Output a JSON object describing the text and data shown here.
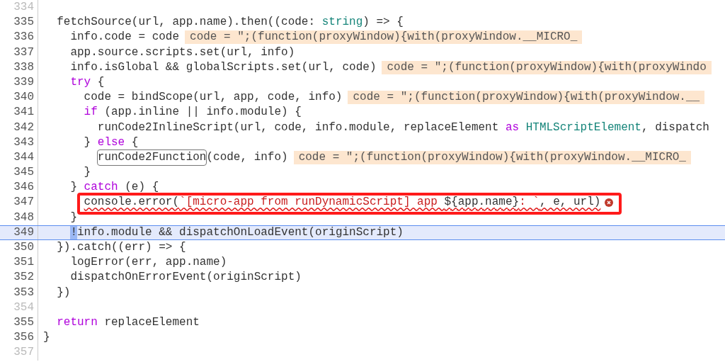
{
  "editor": {
    "lines": [
      {
        "number": "334"
      },
      {
        "number": "335",
        "tokens": [
          {
            "kind": "plain",
            "text": "  fetchSource(url, app.name).then((code: "
          },
          {
            "kind": "type",
            "text": "string"
          },
          {
            "kind": "plain",
            "text": ") => {"
          }
        ]
      },
      {
        "number": "336",
        "tokens": [
          {
            "kind": "plain",
            "text": "    info.code = code"
          },
          {
            "kind": "hint",
            "text": "code = \";(function(proxyWindow){with(proxyWindow.__MICRO_"
          }
        ]
      },
      {
        "number": "337",
        "tokens": [
          {
            "kind": "plain",
            "text": "    app.source.scripts.set(url, info)"
          }
        ]
      },
      {
        "number": "338",
        "tokens": [
          {
            "kind": "plain",
            "text": "    info.isGlobal && globalScripts.set(url, code)"
          },
          {
            "kind": "hint",
            "text": "code = \";(function(proxyWindow){with(proxyWindo"
          }
        ]
      },
      {
        "number": "339",
        "tokens": [
          {
            "kind": "keyword",
            "text": "    try"
          },
          {
            "kind": "plain",
            "text": " {"
          }
        ]
      },
      {
        "number": "340",
        "tokens": [
          {
            "kind": "plain",
            "text": "      code = bindScope(url, app, code, info)"
          },
          {
            "kind": "hint",
            "text": "code = \";(function(proxyWindow){with(proxyWindow.__"
          }
        ]
      },
      {
        "number": "341",
        "tokens": [
          {
            "kind": "keyword",
            "text": "      if"
          },
          {
            "kind": "plain",
            "text": " (app.inline || info.module) {"
          }
        ]
      },
      {
        "number": "342",
        "tokens": [
          {
            "kind": "plain",
            "text": "        runCode2InlineScript(url, code, info.module, replaceElement "
          },
          {
            "kind": "keyword",
            "text": "as"
          },
          {
            "kind": "type",
            "text": " HTMLScriptElement"
          },
          {
            "kind": "plain",
            "text": ", dispatch"
          }
        ]
      },
      {
        "number": "343",
        "tokens": [
          {
            "kind": "plain",
            "text": "      } "
          },
          {
            "kind": "keyword",
            "text": "else"
          },
          {
            "kind": "plain",
            "text": " {"
          }
        ]
      },
      {
        "number": "344",
        "tokens": [
          {
            "kind": "match",
            "text": "        runCode2Function"
          },
          {
            "kind": "plain",
            "text": "(code, info)"
          },
          {
            "kind": "hint",
            "text": "code = \";(function(proxyWindow){with(proxyWindow.__MICRO_"
          }
        ]
      },
      {
        "number": "345",
        "tokens": [
          {
            "kind": "plain",
            "text": "      }"
          }
        ]
      },
      {
        "number": "346",
        "tokens": [
          {
            "kind": "plain",
            "text": "    } "
          },
          {
            "kind": "keyword",
            "text": "catch"
          },
          {
            "kind": "plain",
            "text": " (e) {"
          }
        ]
      },
      {
        "number": "347",
        "annotated": true,
        "error": true,
        "tokens": [
          {
            "kind": "plain",
            "text": "      console.error("
          },
          {
            "kind": "string",
            "text": "`[micro-app from runDynamicScript] app "
          },
          {
            "kind": "plain",
            "text": "${app.name}"
          },
          {
            "kind": "string",
            "text": ": `"
          },
          {
            "kind": "plain",
            "text": ", e, url)"
          }
        ]
      },
      {
        "number": "348",
        "tokens": [
          {
            "kind": "plain",
            "text": "    }"
          }
        ]
      },
      {
        "number": "349",
        "highlighted": true,
        "tokens": [
          {
            "kind": "cursor",
            "text": "    !"
          },
          {
            "kind": "plain",
            "text": "info.module && dispatchOnLoadEvent(originScript)"
          }
        ]
      },
      {
        "number": "350",
        "tokens": [
          {
            "kind": "plain",
            "text": "  }).catch((err) => {"
          }
        ]
      },
      {
        "number": "351",
        "tokens": [
          {
            "kind": "plain",
            "text": "    logError(err, app.name)"
          }
        ]
      },
      {
        "number": "352",
        "tokens": [
          {
            "kind": "plain",
            "text": "    dispatchOnErrorEvent(originScript)"
          }
        ]
      },
      {
        "number": "353",
        "tokens": [
          {
            "kind": "plain",
            "text": "  })"
          }
        ]
      },
      {
        "number": "354"
      },
      {
        "number": "355",
        "tokens": [
          {
            "kind": "keyword",
            "text": "  return"
          },
          {
            "kind": "plain",
            "text": " replaceElement"
          }
        ]
      },
      {
        "number": "356",
        "tokens": [
          {
            "kind": "plain",
            "text": "}"
          }
        ]
      },
      {
        "number": "357"
      }
    ]
  }
}
